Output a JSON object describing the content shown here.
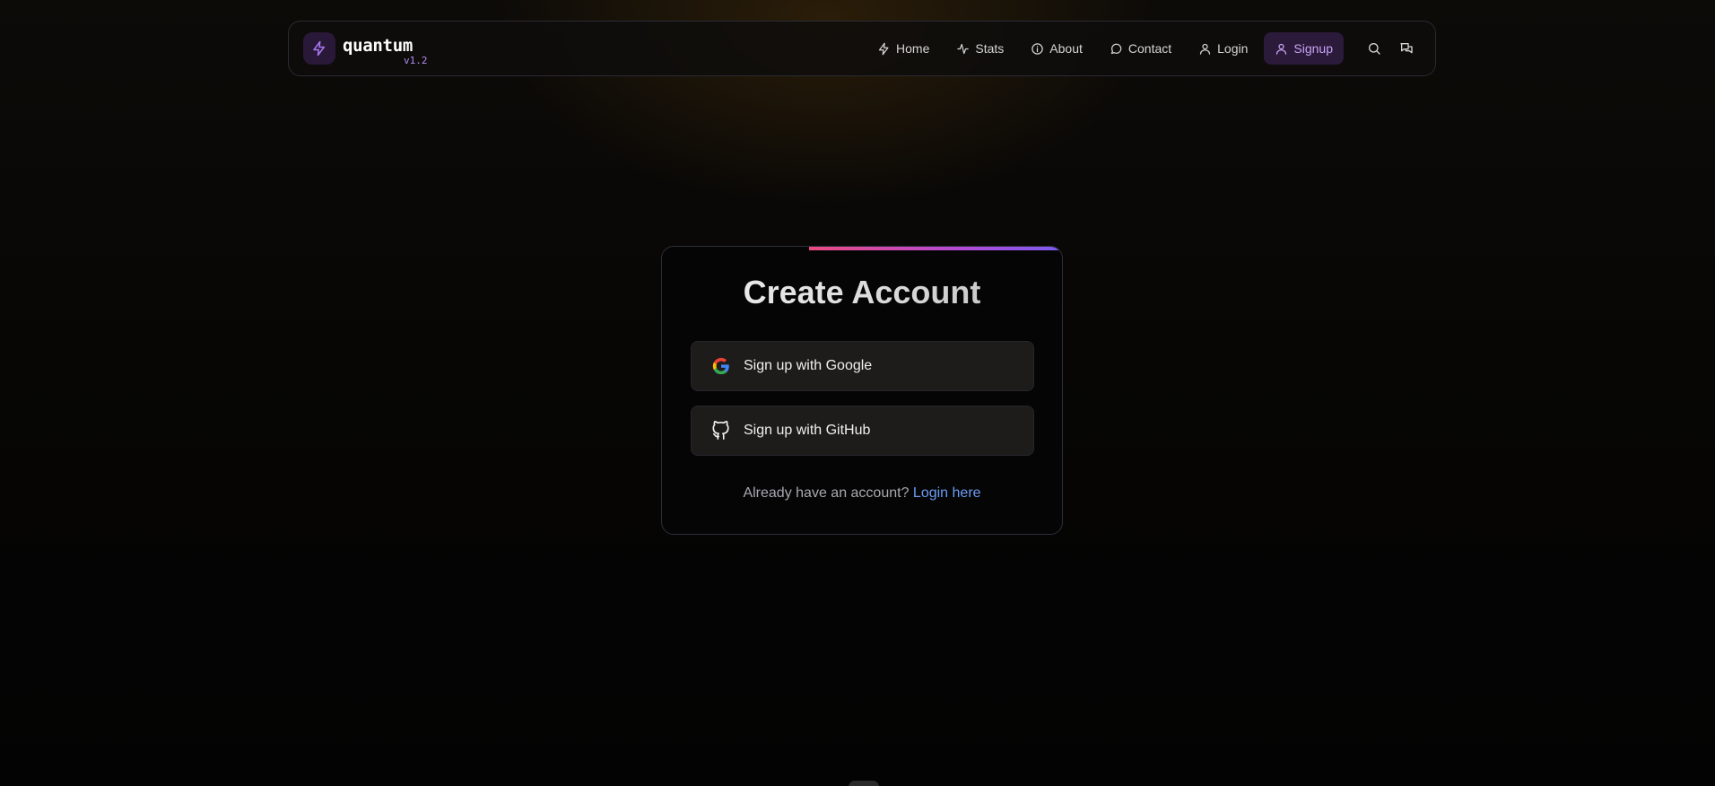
{
  "brand": {
    "name": "quantum",
    "version": "v1.2",
    "logo_icon": "lightning-icon",
    "accent_color": "#8b5cf6"
  },
  "nav": {
    "items": [
      {
        "label": "Home",
        "icon": "lightning-icon"
      },
      {
        "label": "Stats",
        "icon": "activity-icon"
      },
      {
        "label": "About",
        "icon": "info-icon"
      },
      {
        "label": "Contact",
        "icon": "message-circle-icon"
      },
      {
        "label": "Login",
        "icon": "user-icon"
      },
      {
        "label": "Signup",
        "icon": "user-icon",
        "active": true
      }
    ],
    "icons": [
      "search-icon",
      "chat-icon"
    ]
  },
  "card": {
    "title": "Create Account",
    "google_label": "Sign up with Google",
    "github_label": "Sign up with GitHub",
    "signin_prompt": "Already have an account?",
    "signin_link": "Login here",
    "accent_colors": [
      "#ec4b82",
      "#7a5cf0"
    ],
    "link_color": "#6b9cf6"
  }
}
